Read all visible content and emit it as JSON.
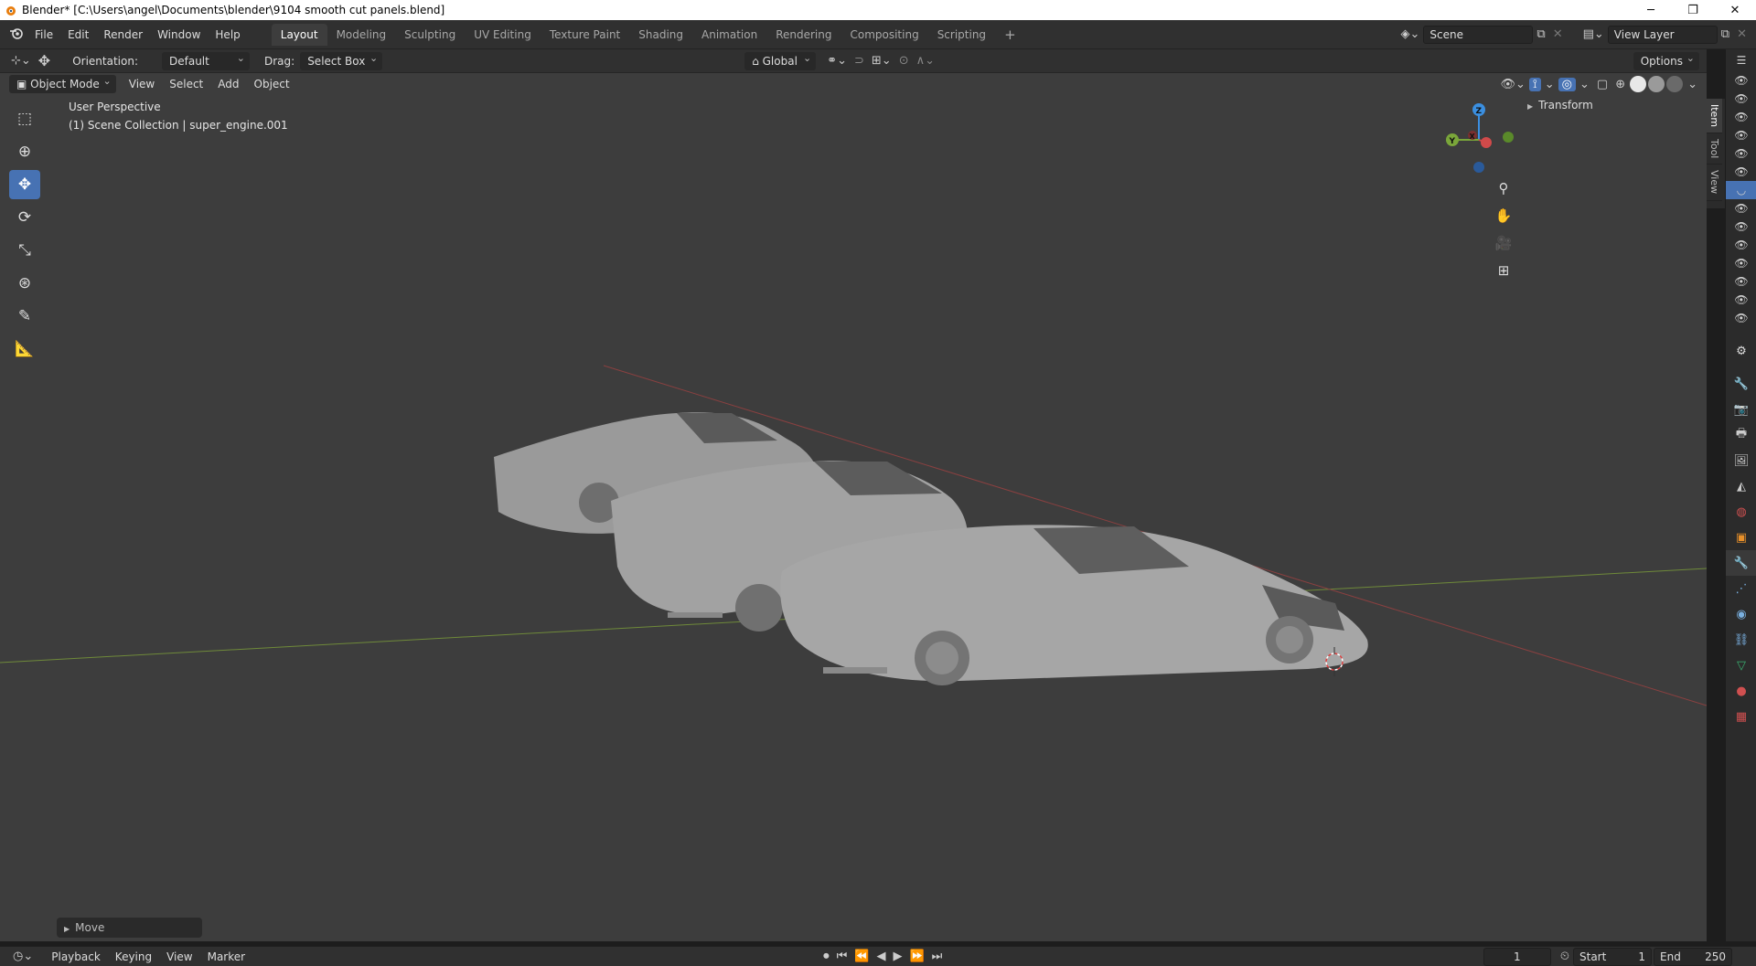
{
  "window": {
    "title": "Blender* [C:\\Users\\angel\\Documents\\blender\\9104 smooth cut panels.blend]",
    "minimize": "─",
    "restore": "❐",
    "close": "✕"
  },
  "menu": [
    "File",
    "Edit",
    "Render",
    "Window",
    "Help"
  ],
  "workspaces": [
    {
      "label": "Layout",
      "active": true
    },
    {
      "label": "Modeling"
    },
    {
      "label": "Sculpting"
    },
    {
      "label": "UV Editing"
    },
    {
      "label": "Texture Paint"
    },
    {
      "label": "Shading"
    },
    {
      "label": "Animation"
    },
    {
      "label": "Rendering"
    },
    {
      "label": "Compositing"
    },
    {
      "label": "Scripting"
    }
  ],
  "add_workspace": "+",
  "scene": {
    "value": "Scene"
  },
  "view_layer": {
    "value": "View Layer"
  },
  "toolheader": {
    "orientation_label": "Orientation:",
    "orientation_value": "Default",
    "drag_label": "Drag:",
    "drag_value": "Select Box",
    "transform_orientation": "Global",
    "options": "Options"
  },
  "viewport_header": {
    "mode": "Object Mode",
    "items": [
      "View",
      "Select",
      "Add",
      "Object"
    ]
  },
  "viewport": {
    "perspective": "User Perspective",
    "collection": "(1) Scene Collection | super_engine.001"
  },
  "gizmo": {
    "z": "Z",
    "y": "Y",
    "x": "X"
  },
  "npanel": {
    "transform": "Transform",
    "tabs": [
      "Item",
      "Tool",
      "View"
    ]
  },
  "last_operator": "Move",
  "timeline": {
    "items": [
      "Playback",
      "Keying",
      "View",
      "Marker"
    ],
    "current_frame": "1",
    "start_label": "Start",
    "start_value": "1",
    "end_label": "End",
    "end_value": "250"
  },
  "colors": {
    "accent": "#4772b3",
    "axis_x": "#d14a4a",
    "axis_y": "#7aa63a",
    "axis_z": "#3b8fe0"
  }
}
